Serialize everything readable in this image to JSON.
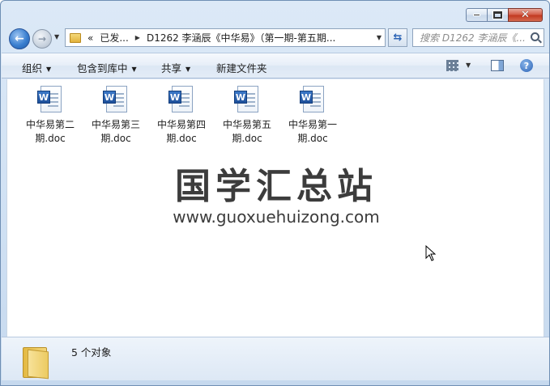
{
  "window": {
    "minimize_glyph": "minimize-icon",
    "maximize_glyph": "maximize-icon",
    "close_glyph": "✕"
  },
  "address": {
    "overflow": "«",
    "crumbs": [
      "已发...",
      "D1262 李涵辰《中华易》（第一期-第五期..."
    ]
  },
  "search": {
    "placeholder": "搜索 D1262 李涵辰《..."
  },
  "toolbar": {
    "organize": "组织",
    "include_in_library": "包含到库中",
    "share": "共享",
    "new_folder": "新建文件夹"
  },
  "files": [
    {
      "line1": "中华易第二",
      "line2": "期.doc"
    },
    {
      "line1": "中华易第三",
      "line2": "期.doc"
    },
    {
      "line1": "中华易第四",
      "line2": "期.doc"
    },
    {
      "line1": "中华易第五",
      "line2": "期.doc"
    },
    {
      "line1": "中华易第一",
      "line2": "期.doc"
    }
  ],
  "file_badge": "W",
  "watermark": {
    "title": "国学汇总站",
    "url": "www.guoxuehuizong.com"
  },
  "status": {
    "count_text": "5 个对象"
  },
  "colors": {
    "accent": "#2a62b5",
    "close": "#c23a22",
    "folder": "#e4b942"
  }
}
